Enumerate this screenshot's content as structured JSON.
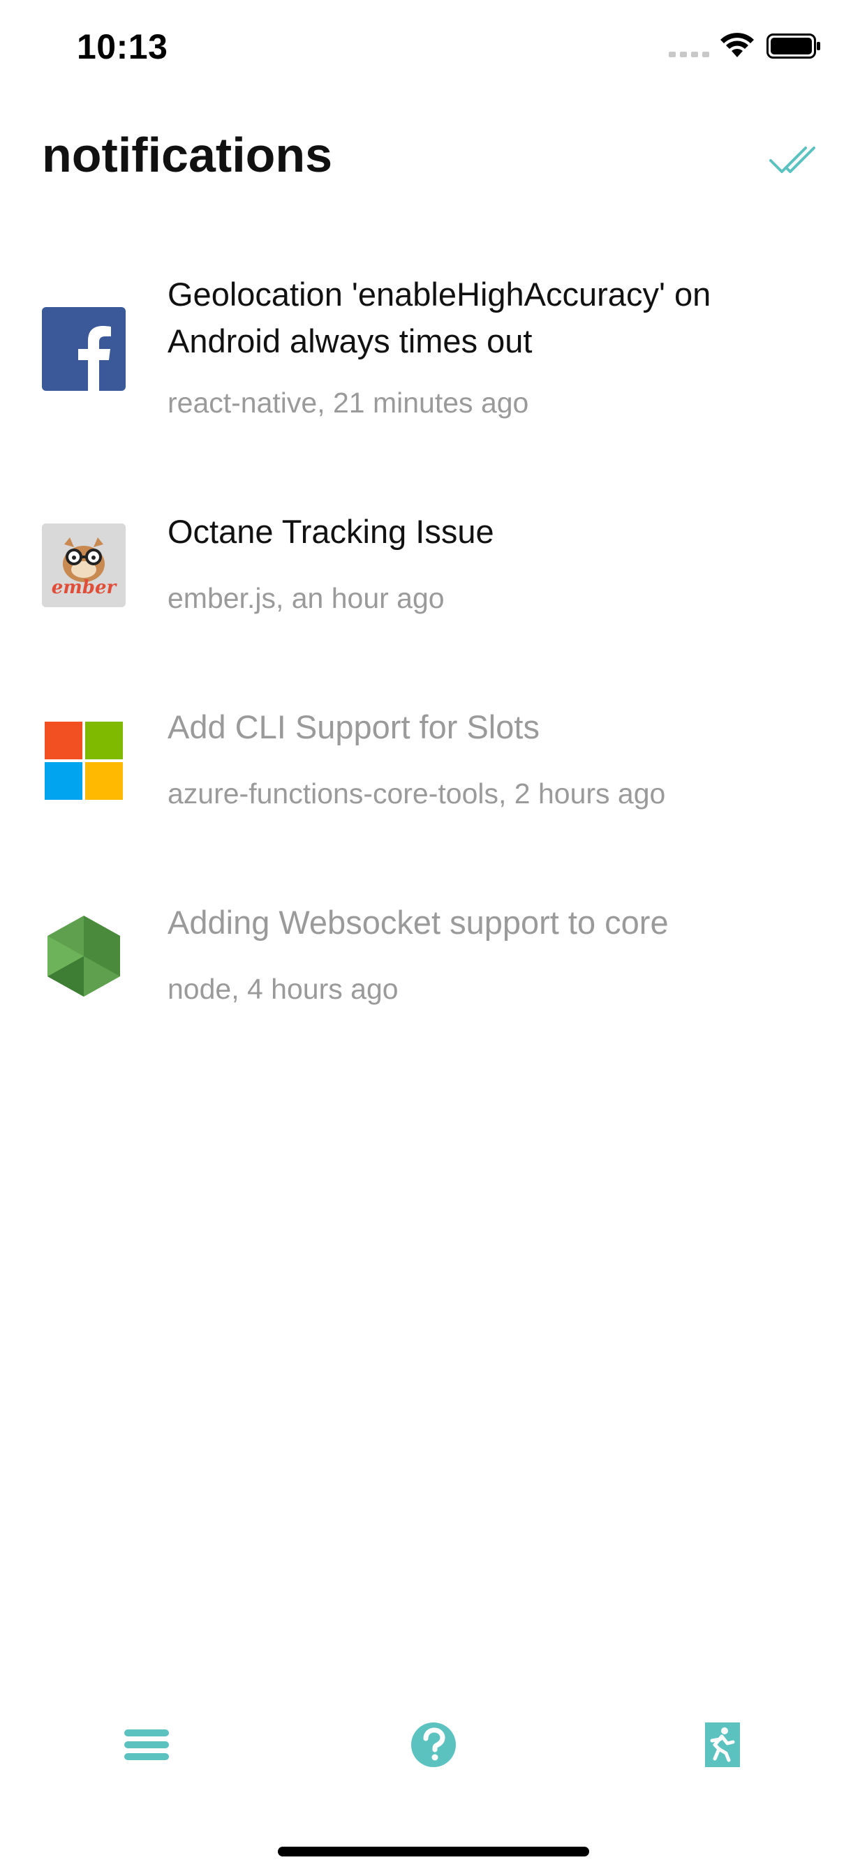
{
  "status_bar": {
    "time": "10:13"
  },
  "header": {
    "title": "notifications",
    "mark_all_read_icon": "double-check-icon"
  },
  "colors": {
    "accent": "#5bc2c0",
    "facebook_blue": "#3b5998",
    "unread_text": "#111111",
    "read_text": "#9a9a9a",
    "meta_text": "#9a9a9a"
  },
  "notifications": [
    {
      "title": "Geolocation 'enableHighAccuracy' on Android always times out",
      "repo": "react-native",
      "time": "21 minutes ago",
      "meta": "react-native, 21 minutes ago",
      "avatar": "facebook-logo",
      "read": false
    },
    {
      "title": "Octane Tracking Issue",
      "repo": "ember.js",
      "time": "an hour ago",
      "meta": "ember.js, an hour ago",
      "avatar": "ember-logo",
      "avatar_text": "ember",
      "read": false
    },
    {
      "title": "Add CLI Support for Slots",
      "repo": "azure-functions-core-tools",
      "time": "2 hours ago",
      "meta": "azure-functions-core-tools, 2 hours ago",
      "avatar": "microsoft-logo",
      "read": true
    },
    {
      "title": "Adding Websocket support to core",
      "repo": "node",
      "time": "4 hours ago",
      "meta": "node, 4 hours ago",
      "avatar": "nodejs-logo",
      "read": true
    }
  ],
  "tab_bar": {
    "items": [
      {
        "icon": "menu-icon"
      },
      {
        "icon": "help-icon"
      },
      {
        "icon": "exit-icon"
      }
    ]
  }
}
